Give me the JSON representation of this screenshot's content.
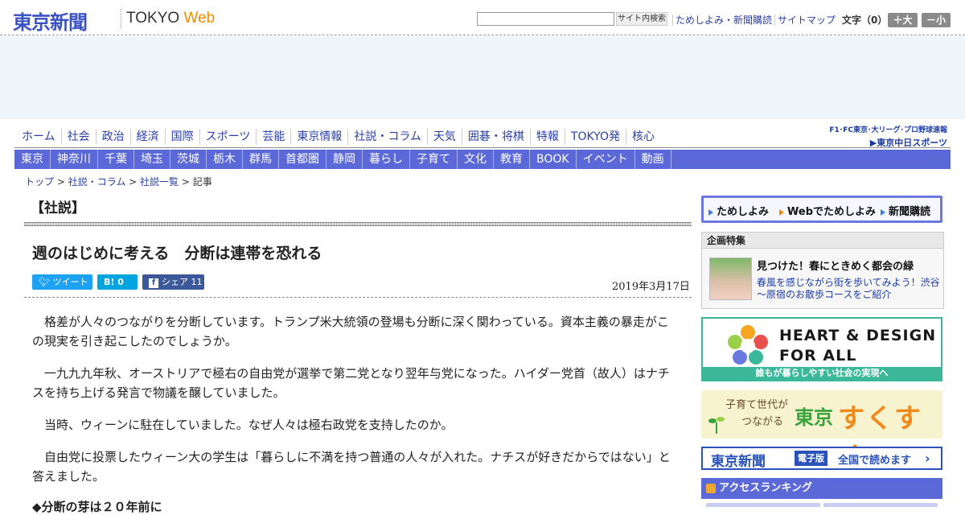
{
  "header": {
    "logo_jp": "東京新聞",
    "logo_en_a": "TOKYO ",
    "logo_en_b": "Web",
    "search_button": "サイト内検索",
    "links": [
      "ためしよみ・新聞購読",
      "サイトマップ"
    ],
    "font_size_label": "文字（0）",
    "font_up": "＋大",
    "font_down": "－小"
  },
  "nav_primary": [
    "ホーム",
    "社会",
    "政治",
    "経済",
    "国際",
    "スポーツ",
    "芸能",
    "東京情報",
    "社説・コラム",
    "天気",
    "囲碁・将棋",
    "特報",
    "TOKYO発",
    "核心"
  ],
  "chunichi": {
    "line1": "F1･FC東京･大リーグ･プロ野球速報",
    "line2": "▶東京中日スポーツ"
  },
  "nav_secondary": [
    "東京",
    "神奈川",
    "千葉",
    "埼玉",
    "茨城",
    "栃木",
    "群馬",
    "首都圏",
    "静岡",
    "暮らし",
    "子育て",
    "文化",
    "教育",
    "BOOK",
    "イベント",
    "動画"
  ],
  "breadcrumb": {
    "c1": "トップ",
    "sep": " > ",
    "c2": "社説・コラム",
    "c3": "社説一覧",
    "c4": "記事"
  },
  "article": {
    "section": "【社説】",
    "title": "週のはじめに考える　分断は連帯を恐れる",
    "share_twitter": "ツイート",
    "share_hatena": "B! 0",
    "share_facebook": "シェア 11",
    "date": "2019年3月17日",
    "paragraphs": [
      "格差が人々のつながりを分断しています。トランプ米大統領の登場も分断に深く関わっている。資本主義の暴走がこの現実を引き起こしたのでしょうか。",
      "一九九九年秋、オーストリアで極右の自由党が選挙で第二党となり翌年与党になった。ハイダー党首（故人）はナチスを持ち上げる発言で物議を醸していました。",
      "当時、ウィーンに駐在していました。なぜ人々は極右政党を支持したのか。",
      "自由党に投票したウィーン大の学生は「暮らしに不満を持つ普通の人々が入れた。ナチスが好きだからではない」と答えました。"
    ],
    "subhead": "◆分断の芽は２０年前に"
  },
  "sidebar": {
    "subscribe": [
      "ためしよみ",
      "Webでためしよみ",
      "新聞購読"
    ],
    "feature_header": "企画特集",
    "feature_title": "見つけた！春にときめく都会の緑",
    "feature_desc": "春風を感じながら街を歩いてみよう！渋谷～原宿のお散歩コースをご紹介",
    "hd_line1": "HEART & DESIGN",
    "hd_line2": "FOR ALL",
    "hd_bar": "誰もが暮らしやすい社会の実現へ",
    "suku_line1": "子育て世代が",
    "suku_line2": "つながる",
    "suku_tokyo": "東京",
    "suku_big": "すくすく",
    "ebook_logo": "東京新聞",
    "ebook_badge": "電子版",
    "ebook_text": "全国で読めます",
    "ranking": "アクセスランキング"
  }
}
